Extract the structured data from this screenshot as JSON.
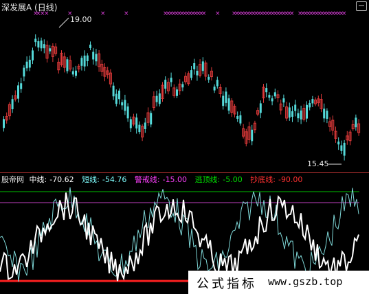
{
  "header": {
    "title": "深发展A",
    "period": "(日线)"
  },
  "price_panel": {
    "high_label": "19.00",
    "low_label": "15.45"
  },
  "indicator_panel": {
    "name": "股帝网",
    "items": [
      {
        "label": "中线:",
        "value": "-70.62",
        "color": "#ffffff"
      },
      {
        "label": "短线:",
        "value": "-54.76",
        "color": "#7fffff"
      },
      {
        "label": "警戒线:",
        "value": "-15.00",
        "color": "#ff40ff"
      },
      {
        "label": "逃顶线:",
        "value": "-5.00",
        "color": "#00e000"
      },
      {
        "label": "抄底线:",
        "value": "-90.00",
        "color": "#ff3030"
      }
    ]
  },
  "footer": {
    "cn": "公式指标",
    "url": "www.gszb.top"
  },
  "colors": {
    "up": "#e03a3a",
    "down": "#55d9d9",
    "marker": "#e040e0"
  }
}
